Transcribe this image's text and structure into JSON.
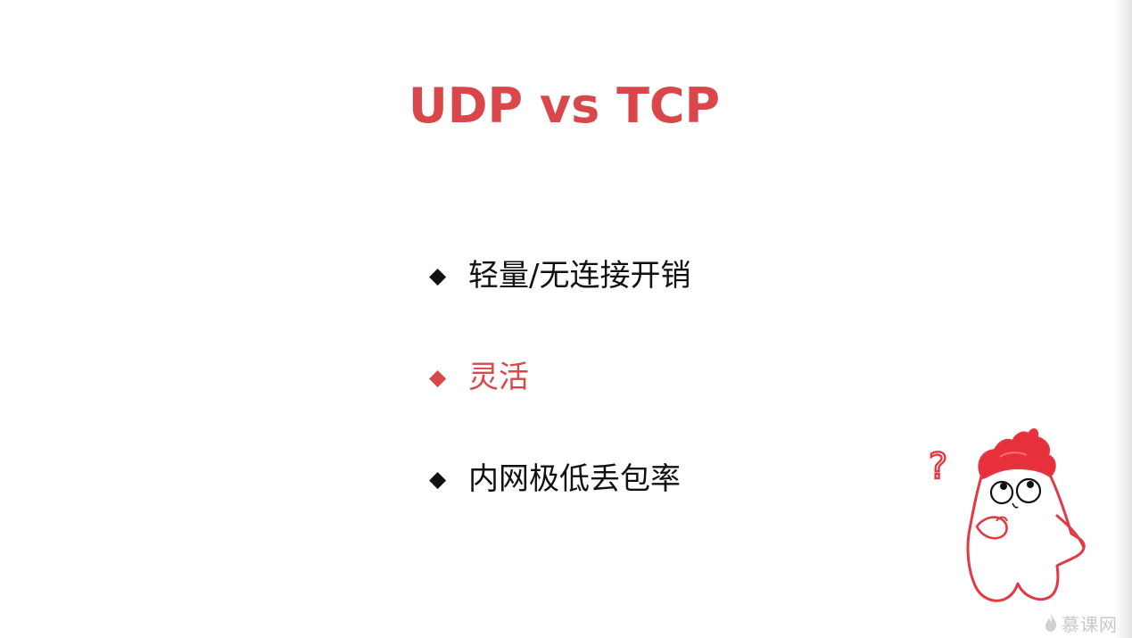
{
  "slide": {
    "title": "UDP vs TCP",
    "colors": {
      "accent": "#d9474b",
      "text": "#111111",
      "watermark": "#c8c8c8"
    },
    "bullets": [
      {
        "marker": "◆",
        "text": "轻量/无连接开销",
        "highlighted": false
      },
      {
        "marker": "◆",
        "text": "灵活",
        "highlighted": true
      },
      {
        "marker": "◆",
        "text": "内网极低丢包率",
        "highlighted": false
      }
    ],
    "mascot": {
      "icon": "confused-mascot-icon",
      "question_marks": "?"
    },
    "watermark": {
      "icon": "flame-logo-icon",
      "text": "慕课网"
    }
  }
}
